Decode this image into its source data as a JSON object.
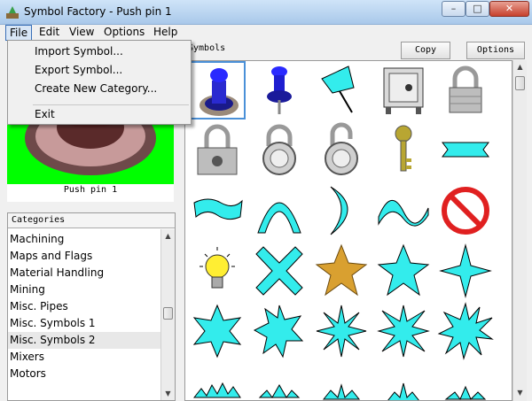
{
  "window": {
    "title": "Symbol Factory - Push pin 1",
    "controls": {
      "minimize": "–",
      "maximize": "□",
      "close": "✕"
    }
  },
  "menubar": [
    {
      "label": "File",
      "active": true
    },
    {
      "label": "Edit"
    },
    {
      "label": "View"
    },
    {
      "label": "Options"
    },
    {
      "label": "Help"
    }
  ],
  "file_menu": {
    "items": [
      "Import Symbol...",
      "Export Symbol...",
      "Create New Category...",
      "Exit"
    ]
  },
  "preview": {
    "label": "Push pin 1",
    "background_color": "#00ff00"
  },
  "categories": {
    "header": "Categories",
    "items": [
      "Machining",
      "Maps and Flags",
      "Material Handling",
      "Mining",
      "Misc. Pipes",
      "Misc. Symbols 1",
      "Misc. Symbols 2",
      "Mixers",
      "Motors"
    ],
    "selected": "Misc. Symbols 2"
  },
  "symbols_panel": {
    "header": "Symbols",
    "copy_button": "Copy",
    "options_button": "Options",
    "symbol_icons": [
      "push-pin-1-icon",
      "push-pin-2-icon",
      "thumbtack-icon",
      "safe-icon",
      "padlock-icon",
      "padlock-keyed-icon",
      "combination-lock-icon",
      "combination-lock-open-icon",
      "key-icon",
      "banner-ribbon-icon",
      "flag-banner-icon",
      "arch-icon",
      "crescent-icon",
      "wave-icon",
      "no-symbol-icon",
      "light-bulb-icon",
      "x-cross-icon",
      "gold-star-icon",
      "five-point-star-icon",
      "four-point-star-icon",
      "six-point-star-icon",
      "seven-point-star-icon",
      "eight-point-star-icon",
      "burst-star-icon",
      "explosion-burst-icon",
      "partial-burst-icon",
      "partial-burst-icon",
      "partial-burst-icon",
      "partial-burst-icon",
      "partial-burst-icon"
    ],
    "selected_symbol": "push-pin-1-icon",
    "accent_color": "#33ecec"
  }
}
